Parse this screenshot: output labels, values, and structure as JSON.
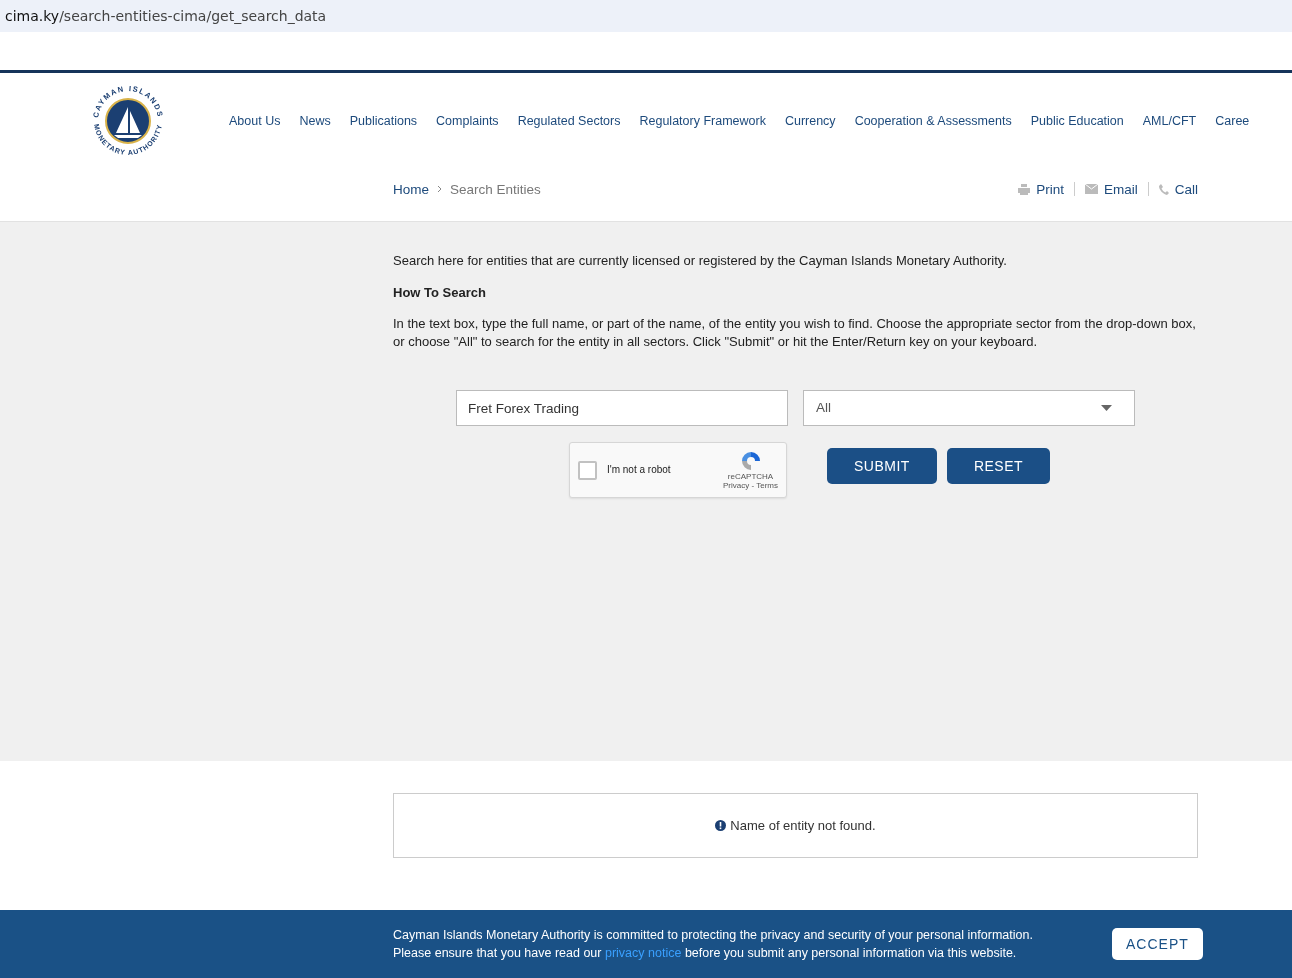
{
  "address_bar": {
    "url_host": "cima.ky",
    "url_path": "/search-entities-cima/get_search_data"
  },
  "logo": {
    "text_top": "CAYMAN ISLANDS",
    "text_bottom": "MONETARY AUTHORITY"
  },
  "nav": [
    "About Us",
    "News",
    "Publications",
    "Complaints",
    "Regulated Sectors",
    "Regulatory Framework",
    "Currency",
    "Cooperation & Assessments",
    "Public Education",
    "AML/CFT",
    "Caree"
  ],
  "breadcrumb": [
    "Home",
    "Search Entities"
  ],
  "actions": [
    {
      "kind": "print",
      "label": "Print"
    },
    {
      "kind": "email",
      "label": "Email"
    },
    {
      "kind": "call",
      "label": "Call"
    }
  ],
  "intro": "Search here for entities that are currently licensed or registered by the Cayman Islands Monetary Authority.",
  "how_to_heading": "How To Search",
  "how_to_text": "In the text box, type the full name, or part of the name, of the entity you wish to find. Choose the appropriate sector from the drop-down box, or choose \"All\" to search for the entity in all sectors. Click \"Submit\" or hit the Enter/Return key on your keyboard.",
  "search": {
    "value": "Fret Forex Trading",
    "sector": "All"
  },
  "captcha": {
    "label": "I'm not a robot",
    "checked": false,
    "brand": "reCAPTCHA",
    "links": "Privacy - Terms"
  },
  "buttons": [
    "SUBMIT",
    "RESET"
  ],
  "result": {
    "message": "Name of entity not found."
  },
  "cookie_banner": {
    "line1": "Cayman Islands Monetary Authority is committed to protecting the privacy and security of your personal information.",
    "line2_before": "Please ensure that you have read our",
    "link": "privacy notice",
    "line2_after": "before you submit any personal information via this website.",
    "button": "ACCEPT"
  }
}
